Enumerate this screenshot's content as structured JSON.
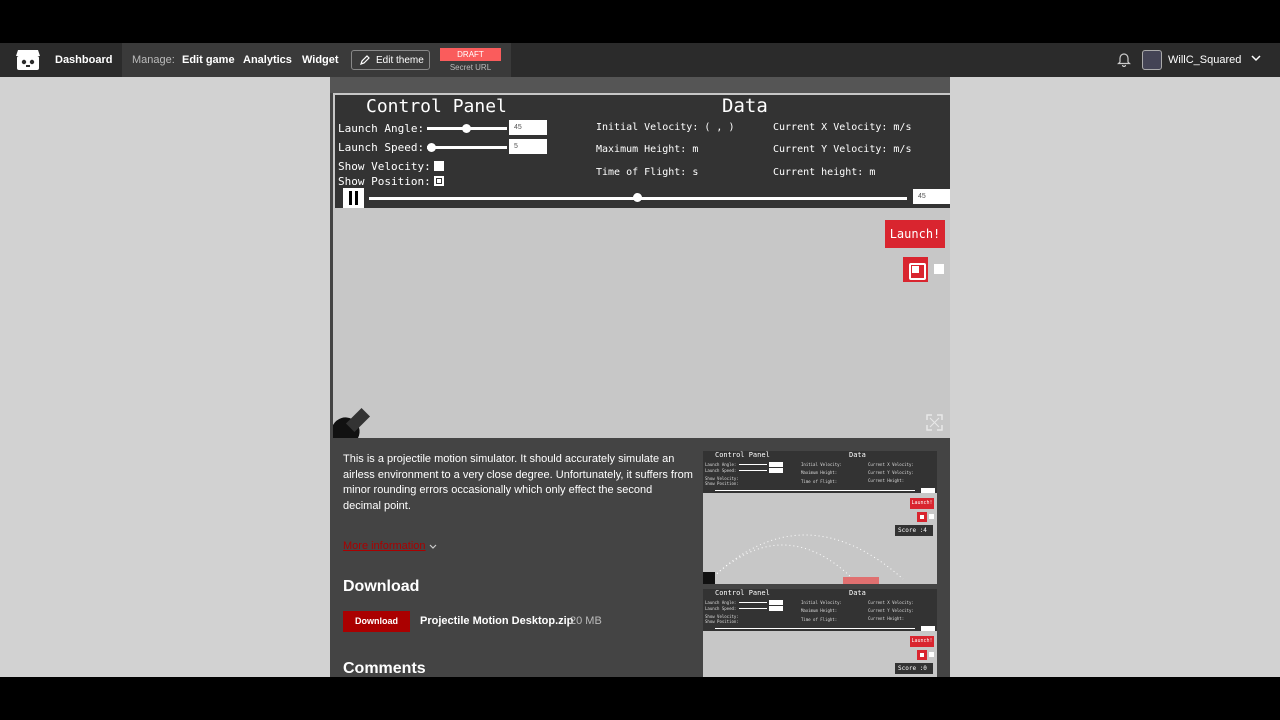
{
  "header": {
    "dashboard": "Dashboard",
    "manage_label": "Manage:",
    "links": [
      "Edit game",
      "Analytics",
      "Widget"
    ],
    "edit_theme": "Edit theme",
    "draft_badge": "DRAFT",
    "secret_url": "Secret URL",
    "username": "WillC_Squared"
  },
  "game": {
    "control_panel_title": "Control Panel",
    "data_title": "Data",
    "launch_angle_label": "Launch Angle:",
    "launch_angle_value": "45",
    "launch_speed_label": "Launch Speed:",
    "launch_speed_value": "5",
    "show_velocity_label": "Show Velocity:",
    "show_position_label": "Show Position:",
    "initial_velocity": "Initial Velocity: ( , )",
    "maximum_height": "Maximum Height: m",
    "time_of_flight": "Time of Flight: s",
    "current_x_velocity": "Current X Velocity: m/s",
    "current_y_velocity": "Current Y Velocity: m/s",
    "current_height": "Current height: m",
    "timeline_value": "45",
    "launch_button": "Launch!"
  },
  "description": "This is a projectile motion simulator. It should accurately simulate an airless environment to a very close degree. Unfortunately, it suffers from minor rounding errors occasionally which only effect the second decimal point.",
  "more_information": "More information",
  "download": {
    "heading": "Download",
    "button": "Download",
    "file_name": "Projectile Motion Desktop.zip",
    "file_size": "20 MB"
  },
  "comments_heading": "Comments",
  "screenshots": [
    {
      "cp": "Control Panel",
      "data": "Data",
      "launch_angle": "Launch Angle:",
      "launch_speed": "Launch Speed:",
      "show_velocity": "Show Velocity:",
      "show_position": "Show Position:",
      "init_vel": "Initial Velocity:",
      "max_height": "Maximum Height:",
      "time_flight": "Time of Flight:",
      "cur_x": "Current X Velocity:",
      "cur_y": "Current Y Velocity:",
      "cur_h": "Current Height:",
      "launch": "Launch!",
      "score": "Score :4"
    },
    {
      "cp": "Control Panel",
      "data": "Data",
      "launch_angle": "Launch Angle:",
      "launch_speed": "Launch Speed:",
      "show_velocity": "Show Velocity:",
      "show_position": "Show Position:",
      "init_vel": "Initial Velocity:",
      "max_height": "Maximum Height:",
      "time_flight": "Time of Flight:",
      "cur_x": "Current X Velocity:",
      "cur_y": "Current Y Velocity:",
      "cur_h": "Current Height:",
      "launch": "Launch!",
      "score": "Score :0"
    }
  ]
}
